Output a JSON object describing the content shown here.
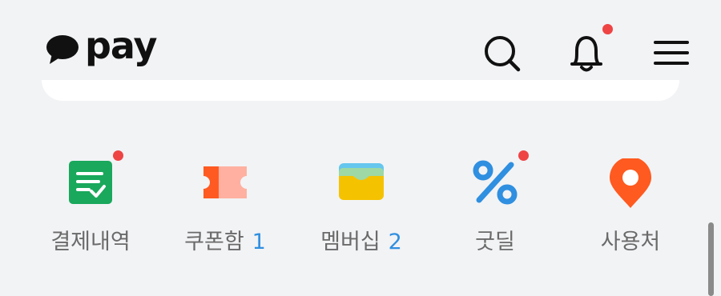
{
  "header": {
    "logo_text": "pay",
    "icons": [
      "search-icon",
      "bell-icon",
      "hamburger-menu-icon"
    ],
    "has_notification": true
  },
  "quick_menu": [
    {
      "label": "결제내역",
      "count": "",
      "icon": "payment-history-icon",
      "has_dot": true
    },
    {
      "label": "쿠폰함",
      "count": "1",
      "icon": "coupon-icon",
      "has_dot": false
    },
    {
      "label": "멤버십",
      "count": "2",
      "icon": "wallet-icon",
      "has_dot": false
    },
    {
      "label": "굿딜",
      "count": "",
      "icon": "percent-icon",
      "has_dot": true
    },
    {
      "label": "사용처",
      "count": "",
      "icon": "location-pin-icon",
      "has_dot": false
    }
  ],
  "colors": {
    "background": "#f2f3f5",
    "notification": "#ee4444",
    "count": "#2f8fe0",
    "label": "#6a6a6a"
  }
}
